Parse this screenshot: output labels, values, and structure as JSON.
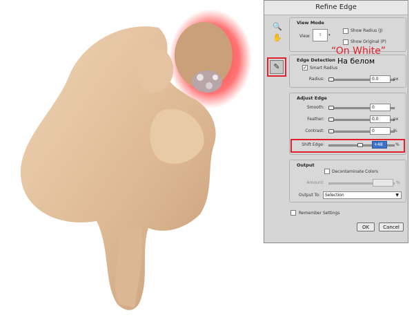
{
  "dialog": {
    "title": "Refine Edge",
    "tools": {
      "zoom_icon": "zoom-icon",
      "hand_icon": "hand-icon",
      "brush_icon": "refine-radius-brush-icon"
    },
    "view_mode": {
      "title": "View Mode",
      "view_label": "View:",
      "show_radius": "Show Radius (J)",
      "show_original": "Show Original (P)"
    },
    "edge_detection": {
      "title": "Edge Detection",
      "smart_radius": "Smart Radius",
      "smart_radius_checked": true,
      "radius_label": "Radius:",
      "radius_value": "0.0",
      "radius_unit": "px"
    },
    "adjust_edge": {
      "title": "Adjust Edge",
      "smooth_label": "Smooth:",
      "smooth_value": "0",
      "feather_label": "Feather:",
      "feather_value": "0.0",
      "feather_unit": "px",
      "contrast_label": "Contrast:",
      "contrast_value": "0",
      "contrast_unit": "%",
      "shift_label": "Shift Edge:",
      "shift_value": "+48",
      "shift_unit": "%"
    },
    "output": {
      "title": "Output",
      "decontaminate": "Decontaminate Colors",
      "amount_label": "Amount:",
      "amount_unit": "%",
      "output_to_label": "Output To:",
      "output_to_value": "Selection"
    },
    "remember_settings": "Remember Settings",
    "ok": "OK",
    "cancel": "Cancel"
  },
  "annotations": {
    "english": "“On White”",
    "russian": "На белом"
  },
  "colors": {
    "highlight": "#e0202a",
    "dialog_bg": "#d6d6d6"
  }
}
